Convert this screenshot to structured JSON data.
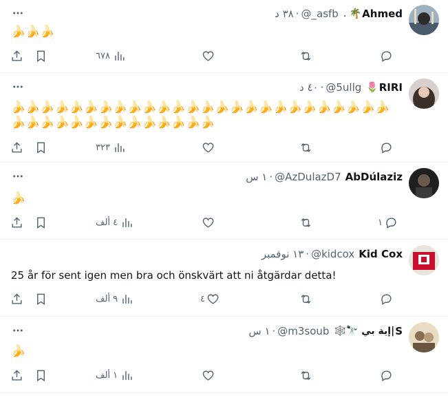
{
  "tweets": [
    {
      "name": "Ahmed",
      "badge": ". 🌴",
      "handle": "@_asfb",
      "dot": "·",
      "time": "٣٨ د",
      "text": "🍌🍌🍌",
      "emoji": true,
      "views": "٦٧٨",
      "likes": "",
      "replies": "",
      "avatar_color": "#4a5a6b"
    },
    {
      "name": "RIRI",
      "badge": "🌷",
      "handle": "@5ullg",
      "dot": "·",
      "time": "٤٠ د",
      "text": "🍌🍌🍌🍌🍌🍌🍌🍌🍌🍌🍌🍌🍌🍌🍌🍌🍌🍌🍌🍌🍌🍌🍌🍌🍌🍌🍌🍌🍌🍌🍌🍌🍌🍌🍌🍌🍌🍌🍌🍌",
      "emoji": true,
      "views": "٣٢٣",
      "likes": "",
      "replies": "",
      "avatar_color": "#b9aca6"
    },
    {
      "name": "AbDúlaziz",
      "badge": "",
      "handle": "@AzDulazD7",
      "dot": "·",
      "time": "١ س",
      "text": "🍌",
      "emoji": true,
      "views": "٤ ألف",
      "likes": "",
      "replies": "١",
      "avatar_color": "#2d2d2d"
    },
    {
      "name": "Kid Cox",
      "badge": "",
      "handle": "@kidcox",
      "dot": "·",
      "time": "١٣ نوفمبر",
      "text": "25 år för sent igen men bra och önskvärt att ni åtgärdar detta!",
      "emoji": false,
      "views": "٩ ألف",
      "likes": "٤",
      "replies": "",
      "avatar_color": "#c8102e"
    },
    {
      "name": "S",
      "badge": "🕸️🔭 إية بي|",
      "handle": "@m3soub",
      "dot": "·",
      "time": "١ س",
      "text": "🍌",
      "emoji": true,
      "views": "١ ألف",
      "likes": "",
      "replies": "",
      "avatar_color": "#c8b89a"
    }
  ]
}
